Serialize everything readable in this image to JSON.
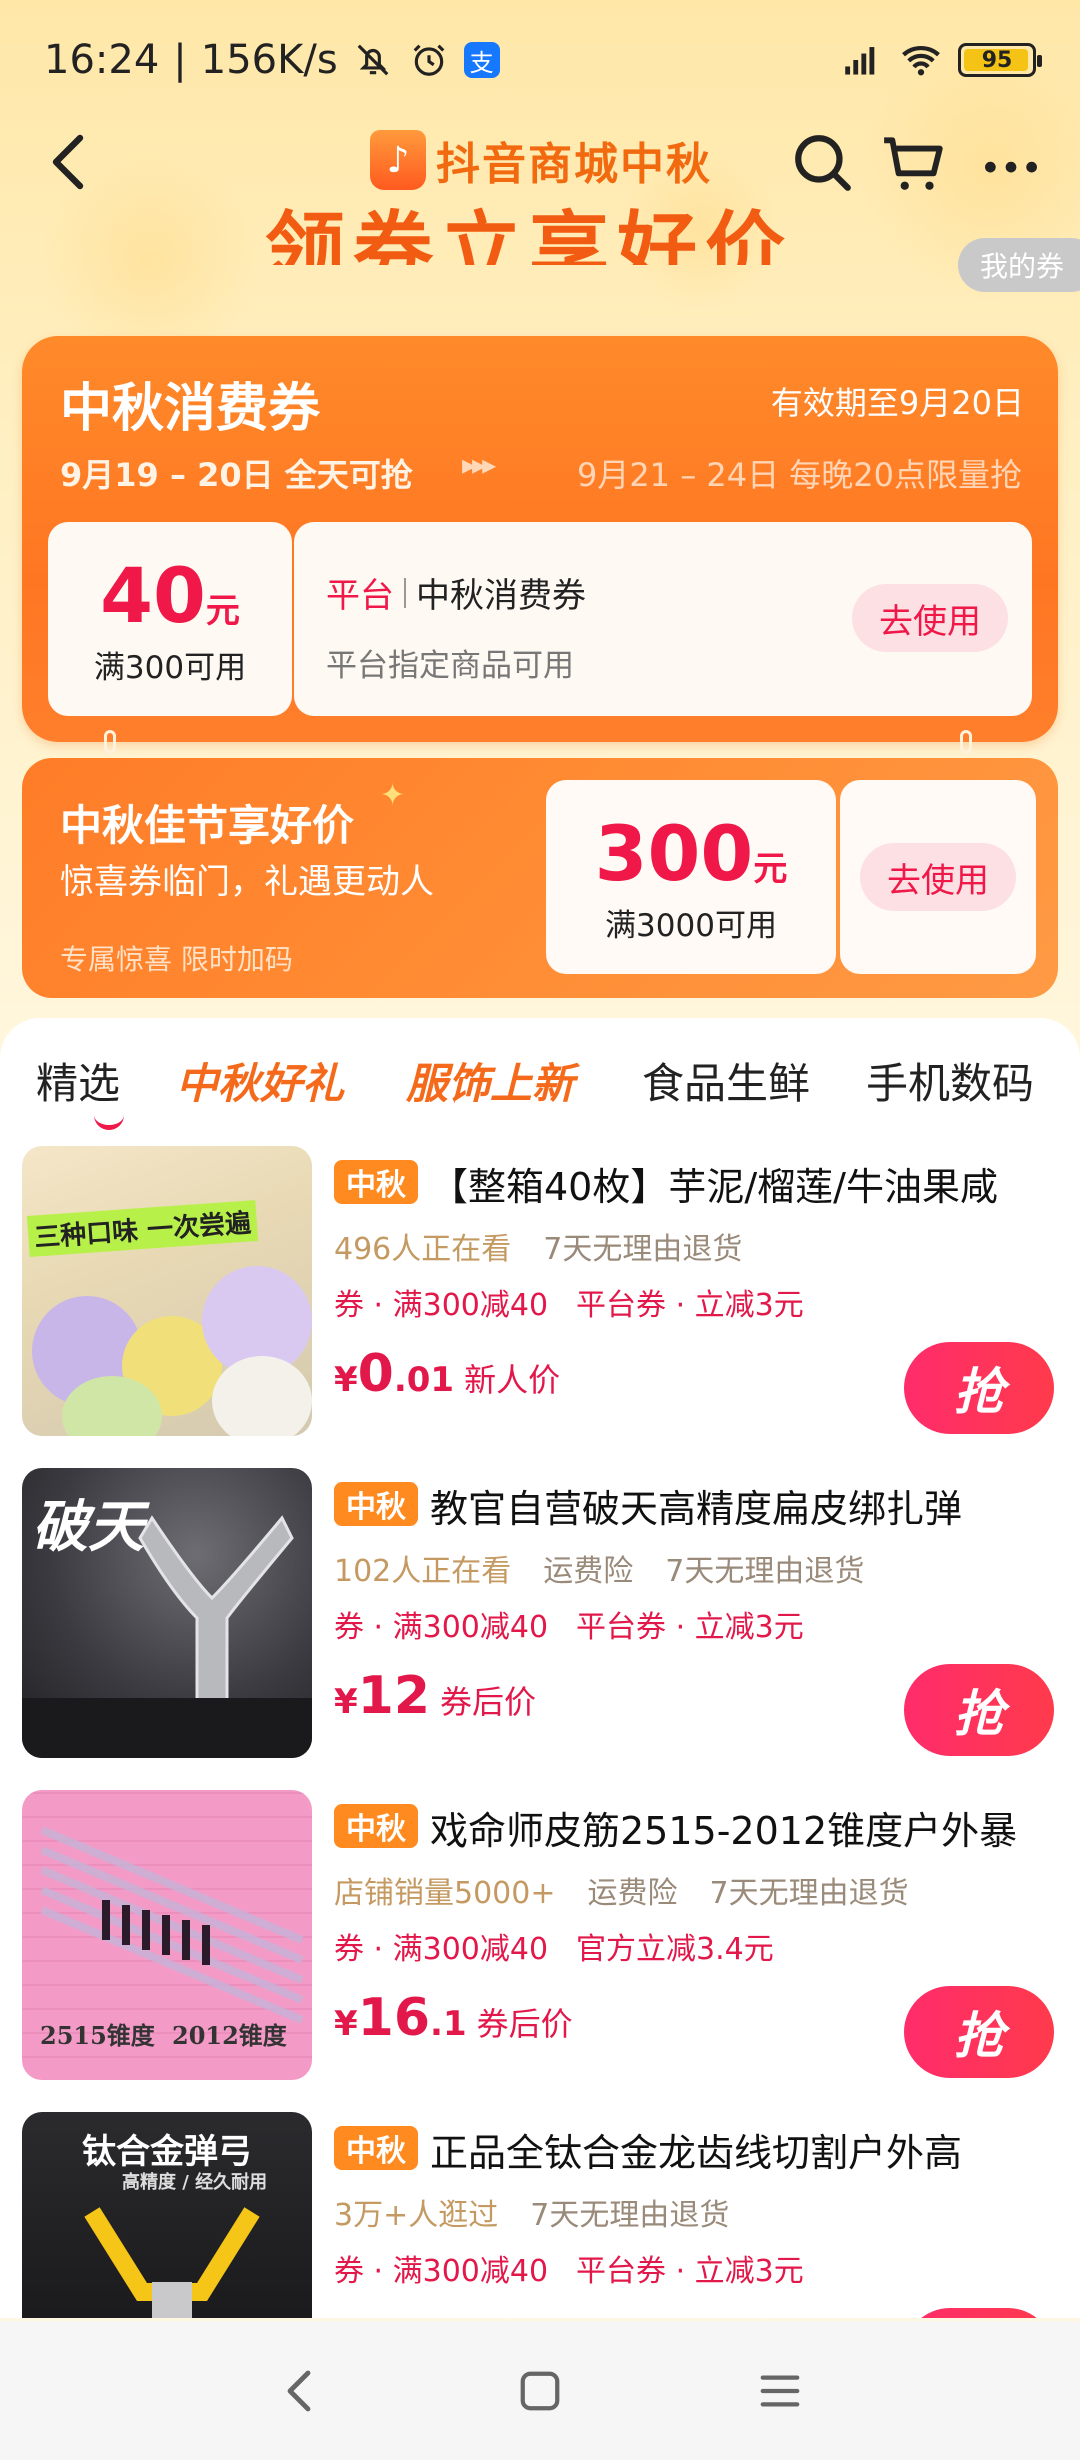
{
  "status_bar": {
    "time": "16:24",
    "speed": "156K/s",
    "battery": "95"
  },
  "header": {
    "title": "抖音商城中秋",
    "logo_glyph": "♪"
  },
  "banner": {
    "slogan": "领券立享好价",
    "my_coupon": "我的券"
  },
  "coupon_main": {
    "title": "中秋消费券",
    "valid": "有效期至9月20日",
    "phase1": "9月19 – 20日 全天可抢",
    "arrows": "▸▸▸",
    "phase2": "9月21 – 24日 每晚20点限量抢",
    "amount": "40",
    "unit": "元",
    "condition": "满300可用",
    "platform": "平台",
    "name": "中秋消费券",
    "desc": "平台指定商品可用",
    "button": "去使用"
  },
  "coupon_second": {
    "title": "中秋佳节享好价",
    "subtitle": "惊喜券临门，礼遇更动人",
    "small": "专属惊喜 限时加码",
    "amount": "300",
    "unit": "元",
    "condition": "满3000可用",
    "button": "去使用"
  },
  "tabs": [
    "精选",
    "中秋好礼",
    "服饰上新",
    "食品生鲜",
    "手机数码"
  ],
  "products": [
    {
      "tag": "中秋",
      "title": "【整箱40枚】芋泥/榴莲/牛油果咸",
      "meta": [
        "496人正在看",
        "7天无理由退货"
      ],
      "coupons": [
        "券 · 满300减40",
        "平台券 · 立减3元"
      ],
      "price_yen": "¥",
      "price_int": "0",
      "price_dec": ".01",
      "price_label": "新人价",
      "grab": "抢",
      "img_text": "三种口味 一次尝遍"
    },
    {
      "tag": "中秋",
      "title": "教官自营破天高精度扁皮绑扎弹",
      "meta": [
        "102人正在看",
        "运费险",
        "7天无理由退货"
      ],
      "coupons": [
        "券 · 满300减40",
        "平台券 · 立减3元"
      ],
      "price_yen": "¥",
      "price_int": "12",
      "price_dec": "",
      "price_label": "券后价",
      "grab": "抢",
      "img_text": "破天"
    },
    {
      "tag": "中秋",
      "title": "戏命师皮筋2515-2012锥度户外暴",
      "meta": [
        "店铺销量5000+",
        "运费险",
        "7天无理由退货"
      ],
      "coupons": [
        "券 · 满300减40",
        "官方立减3.4元"
      ],
      "price_yen": "¥",
      "price_int": "16",
      "price_dec": ".1",
      "price_label": "券后价",
      "grab": "抢",
      "img_text_a": "2515锥度",
      "img_text_b": "2012锥度"
    },
    {
      "tag": "中秋",
      "title": "正品全钛合金龙齿线切割户外高",
      "meta": [
        "3万+人逛过",
        "7天无理由退货"
      ],
      "coupons": [
        "券 · 满300减40",
        "平台券 · 立减3元"
      ],
      "img_text": "钛合金弹弓",
      "img_sub": "高精度 / 经久耐用"
    }
  ],
  "colors": {
    "accent_orange": "#ff7a24",
    "price_red": "#e3184a",
    "tag_orange": "#ff8a1f"
  }
}
